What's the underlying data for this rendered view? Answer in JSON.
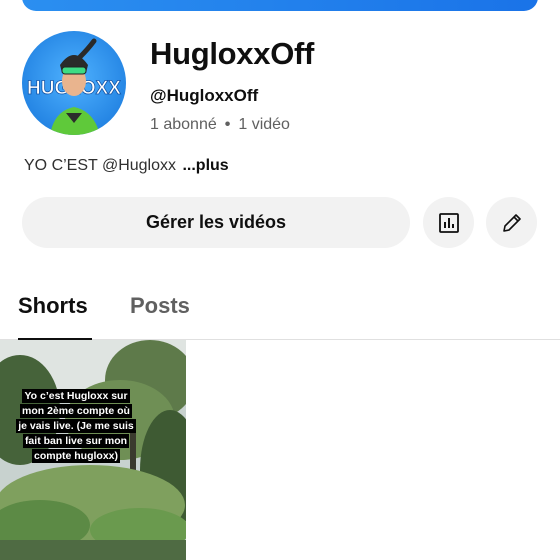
{
  "channel": {
    "name": "HugloxxOff",
    "handle": "@HugloxxOff",
    "subscribers": "1 abonné",
    "separator": "•",
    "videos": "1 vidéo",
    "avatar_text": "HUGLOXX",
    "description": "YO C’EST @Hugloxx",
    "more_label": "...plus"
  },
  "actions": {
    "manage_label": "Gérer les vidéos",
    "analytics_icon": "bar-chart-icon",
    "edit_icon": "pencil-icon"
  },
  "tabs": [
    {
      "label": "Shorts",
      "active": true
    },
    {
      "label": "Posts",
      "active": false
    }
  ],
  "shorts": [
    {
      "caption": "Yo c’est Hugloxx sur mon 2ème compte où je vais live. (Je me suis fait ban live sur mon compte hugloxx)"
    }
  ],
  "colors": {
    "banner": "#1a73e8",
    "avatar_bg": "#2a8ff0",
    "button_bg": "#f2f2f2",
    "secondary_text": "#606060"
  }
}
